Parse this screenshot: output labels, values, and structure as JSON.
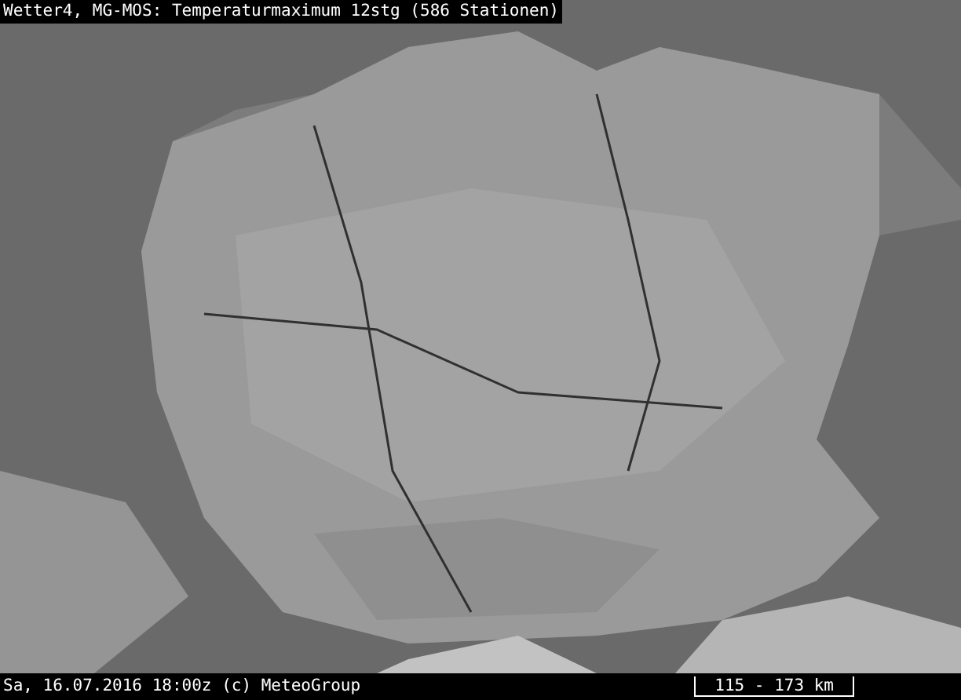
{
  "title": "Wetter4, MG-MOS: Temperaturmaximum 12stg (586 Stationen)",
  "status_bar": {
    "timestamp": "Sa, 16.07.2016 18:00z (c) MeteoGroup",
    "scale": "115 - 173 km"
  }
}
